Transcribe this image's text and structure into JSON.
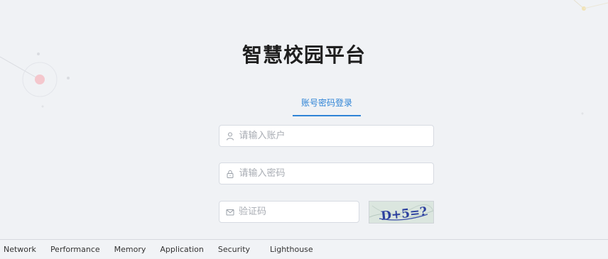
{
  "header": {
    "title": "智慧校园平台"
  },
  "tabs": [
    {
      "label": "账号密码登录",
      "active": true
    }
  ],
  "form": {
    "account": {
      "placeholder": "请输入账户",
      "value": "",
      "icon": "user-icon"
    },
    "password": {
      "placeholder": "请输入密码",
      "value": "",
      "icon": "lock-icon"
    },
    "captcha": {
      "placeholder": "验证码",
      "value": "",
      "icon": "mail-icon",
      "image_text": "D+5=?"
    }
  },
  "devtools": {
    "tabs": [
      "Network",
      "Performance",
      "Memory",
      "Application",
      "Security",
      "Lighthouse"
    ]
  },
  "colors": {
    "accent": "#2f84d6",
    "background": "#f0f2f5"
  }
}
